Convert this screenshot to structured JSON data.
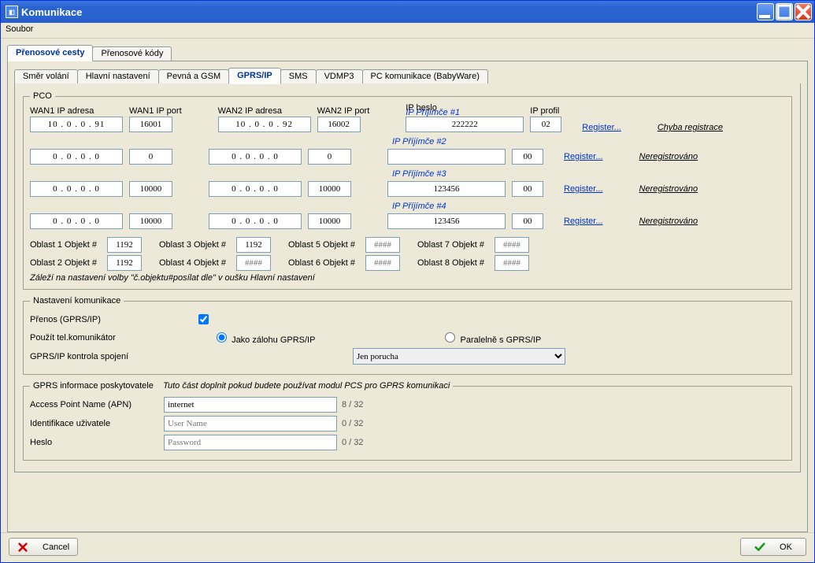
{
  "window": {
    "title": "Komunikace"
  },
  "menu": {
    "file": "Soubor"
  },
  "tabs_main": [
    {
      "label": "Přenosové cesty",
      "active": true
    },
    {
      "label": "Přenosové kódy",
      "active": false
    }
  ],
  "tabs_sub": [
    {
      "label": "Směr volání"
    },
    {
      "label": "Hlavní nastavení"
    },
    {
      "label": "Pevná a GSM"
    },
    {
      "label": "GPRS/IP",
      "active": true
    },
    {
      "label": "SMS"
    },
    {
      "label": "VDMP3"
    },
    {
      "label": "PC komunikace (BabyWare)"
    }
  ],
  "pco": {
    "legend": "PCO",
    "hdr_wan1_ip": "WAN1 IP adresa",
    "hdr_wan1_port": "WAN1 IP port",
    "hdr_wan2_ip": "WAN2 IP adresa",
    "hdr_wan2_port": "WAN2 IP port",
    "hdr_ipheslo": "IP heslo",
    "hdr_ipprofil": "IP profil",
    "receivers": [
      {
        "lbl": "IP Příjímče #1",
        "w1ip": "10 . 0 . 0 . 91",
        "w1p": "16001",
        "w2ip": "10 . 0 . 0 . 92",
        "w2p": "16002",
        "pwd": "222222",
        "profil": "02",
        "register": "Register...",
        "status": "Chyba registrace"
      },
      {
        "lbl": "IP Příjímče #2",
        "w1ip": "0 . 0 . 0 . 0",
        "w1p": "0",
        "w2ip": "0 . 0 . 0 . 0",
        "w2p": "0",
        "pwd": "",
        "profil": "00",
        "register": "Register...",
        "status": "Neregistrováno"
      },
      {
        "lbl": "IP Příjímče #3",
        "w1ip": "0 . 0 . 0 . 0",
        "w1p": "10000",
        "w2ip": "0 . 0 . 0 . 0",
        "w2p": "10000",
        "pwd": "123456",
        "profil": "00",
        "register": "Register...",
        "status": "Neregistrováno"
      },
      {
        "lbl": "IP Příjímče #4",
        "w1ip": "0 . 0 . 0 . 0",
        "w1p": "10000",
        "w2ip": "0 . 0 . 0 . 0",
        "w2p": "10000",
        "pwd": "123456",
        "profil": "00",
        "register": "Register...",
        "status": "Neregistrováno"
      }
    ],
    "oblast": {
      "lbl1": "Oblast 1 Objekt #",
      "v1": "1192",
      "lbl2": "Oblast 2 Objekt #",
      "v2": "1192",
      "lbl3": "Oblast 3 Objekt #",
      "v3": "1192",
      "lbl4": "Oblast 4 Objekt #",
      "ph4": "####",
      "lbl5": "Oblast 5 Objekt #",
      "ph5": "####",
      "lbl6": "Oblast 6 Objekt #",
      "ph6": "####",
      "lbl7": "Oblast 7 Objekt #",
      "ph7": "####",
      "lbl8": "Oblast 8 Objekt #",
      "ph8": "####"
    },
    "note": "Záleží na nastavení volby \"č.objektu#posílat dle\" v oušku Hlavní nastavení"
  },
  "komm": {
    "legend": "Nastavení komunikace",
    "prenos_lbl": "Přenos (GPRS/IP)",
    "prenos_checked": true,
    "usephonelbl": "Použít tel.komunikátor",
    "opt_backup": "Jako zálohu GPRS/IP",
    "opt_parallel": "Paralelně s GPRS/IP",
    "opt_selected": "backup",
    "kontrola_lbl": "GPRS/IP kontrola spojení",
    "kontrola_value": "Jen porucha"
  },
  "gprs": {
    "legend": "GPRS informace poskytovatele",
    "hint": "Tuto část doplnit pokud budete používat modul PCS pro GPRS komunikaci",
    "apn_lbl": "Access Point Name (APN)",
    "apn_val": "internet",
    "apn_cnt": "8 / 32",
    "user_lbl": "Identifikace uživatele",
    "user_ph": "User Name",
    "user_cnt": "0 / 32",
    "pass_lbl": "Heslo",
    "pass_ph": "Password",
    "pass_cnt": "0 / 32"
  },
  "buttons": {
    "cancel": "Cancel",
    "ok": "OK"
  }
}
